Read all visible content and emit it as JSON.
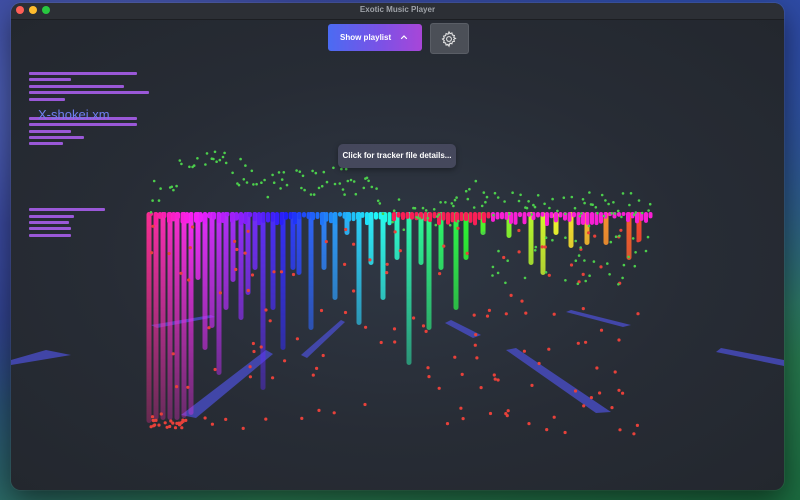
{
  "window": {
    "title": "Exotic Music Player"
  },
  "toolbar": {
    "playlist_button_label": "Show playlist",
    "playlist_button_icon": "chevron-up-icon",
    "settings_button_icon": "gear-icon"
  },
  "visualizer": {
    "tooltip": "Click for tracker file details...",
    "filename": "X-shokei.xm",
    "colors": {
      "scatter": "#4ccf4c",
      "dots": "#e8413a",
      "road": "#4b4fcf",
      "hud": "#9a58d8"
    }
  }
}
